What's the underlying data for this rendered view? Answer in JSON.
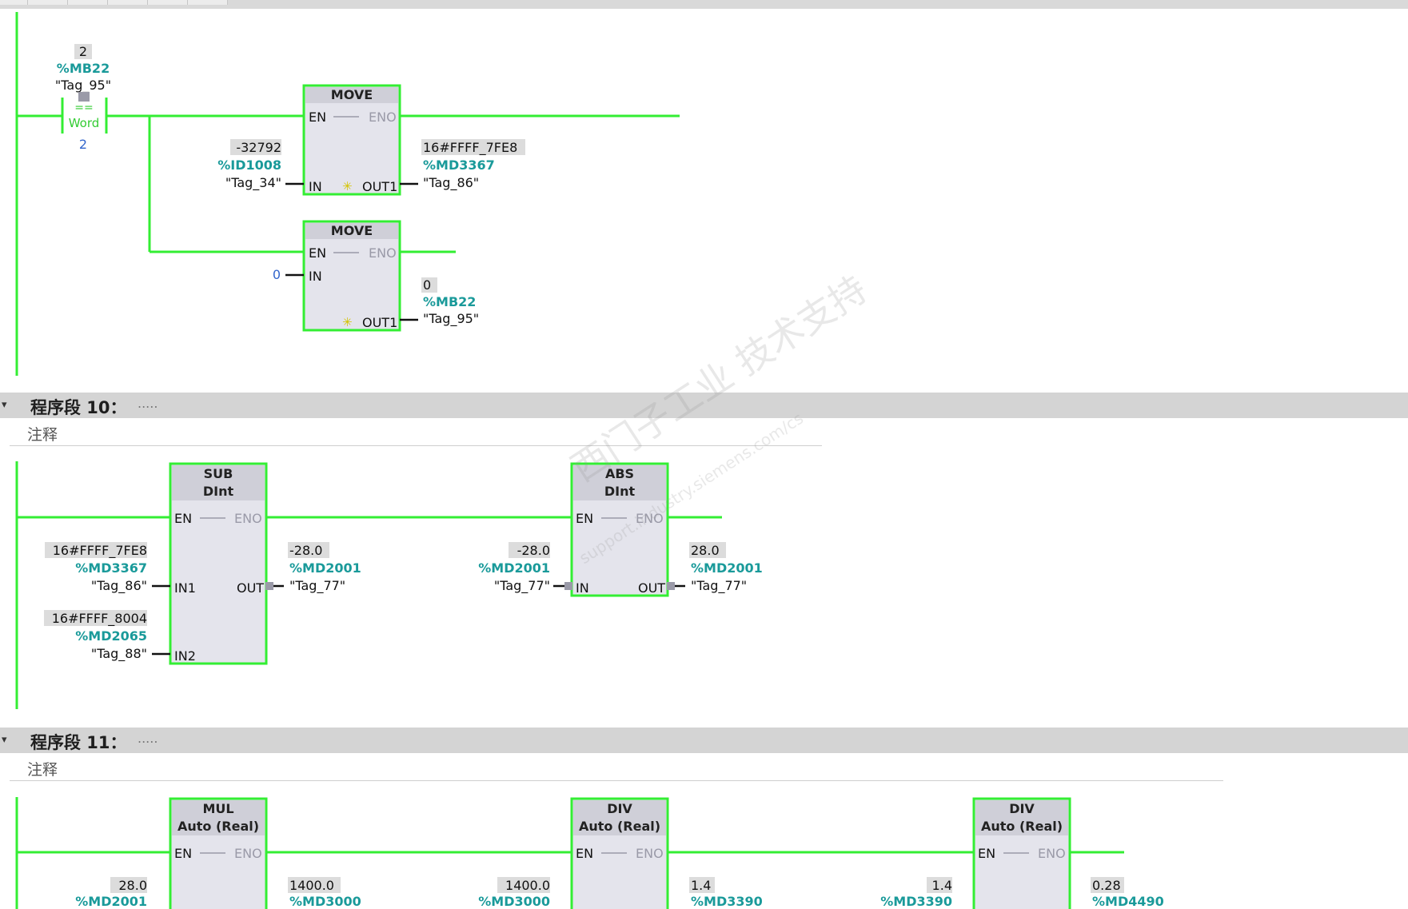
{
  "top_tabs": [
    "",
    "",
    "",
    "",
    ""
  ],
  "networks": [
    {
      "title": "程序段 10：",
      "dots": ".....",
      "comment": "注释"
    },
    {
      "title": "程序段 11：",
      "dots": ".....",
      "comment": "注释"
    }
  ],
  "network9": {
    "compare": {
      "value": "2",
      "address": "%MB22",
      "tag": "\"Tag_95\"",
      "op": "==",
      "type": "Word",
      "operand2": "2"
    },
    "move1": {
      "title": "MOVE",
      "en": "EN",
      "eno": "ENO",
      "in": "IN",
      "out": "OUT1",
      "in_value": "-32792",
      "in_address": "%ID1008",
      "in_tag": "\"Tag_34\"",
      "out_value": "16#FFFF_7FE8",
      "out_address": "%MD3367",
      "out_tag": "\"Tag_86\""
    },
    "move2": {
      "title": "MOVE",
      "en": "EN",
      "eno": "ENO",
      "in": "IN",
      "out": "OUT1",
      "in_value": "0",
      "out_value": "0",
      "out_address": "%MB22",
      "out_tag": "\"Tag_95\""
    }
  },
  "network10": {
    "sub": {
      "title": "SUB",
      "type": "DInt",
      "en": "EN",
      "eno": "ENO",
      "in1": "IN1",
      "in2": "IN2",
      "out": "OUT",
      "in1_value": "16#FFFF_7FE8",
      "in1_address": "%MD3367",
      "in1_tag": "\"Tag_86\"",
      "in2_value": "16#FFFF_8004",
      "in2_address": "%MD2065",
      "in2_tag": "\"Tag_88\"",
      "out_value": "-28.0",
      "out_address": "%MD2001",
      "out_tag": "\"Tag_77\""
    },
    "abs": {
      "title": "ABS",
      "type": "DInt",
      "en": "EN",
      "eno": "ENO",
      "in": "IN",
      "out": "OUT",
      "in_value": "-28.0",
      "in_address": "%MD2001",
      "in_tag": "\"Tag_77\"",
      "out_value": "28.0",
      "out_address": "%MD2001",
      "out_tag": "\"Tag_77\""
    }
  },
  "network11": {
    "mul": {
      "title": "MUL",
      "type": "Auto (Real)",
      "en": "EN",
      "eno": "ENO",
      "in1_value": "28.0",
      "in1_address": "%MD2001",
      "out_value": "1400.0",
      "out_address": "%MD3000"
    },
    "div1": {
      "title": "DIV",
      "type": "Auto (Real)",
      "en": "EN",
      "eno": "ENO",
      "in1_value": "1400.0",
      "in1_address": "%MD3000",
      "out_value": "1.4",
      "out_address": "%MD3390"
    },
    "div2": {
      "title": "DIV",
      "type": "Auto (Real)",
      "en": "EN",
      "eno": "ENO",
      "in1_value": "1.4",
      "in1_address": "%MD3390",
      "out_value": "0.28",
      "out_address": "%MD4490"
    }
  },
  "watermark": "西门子工业 技术支持",
  "watermark_url": "support.industry.siemens.com/cs",
  "colors": {
    "rung": "#33ee33",
    "box_fill": "#e4e4ec",
    "box_header": "#cfcfd8",
    "address": "#1a9a9a",
    "value_bg": "#dcdcdc",
    "literal": "#3366cc"
  }
}
